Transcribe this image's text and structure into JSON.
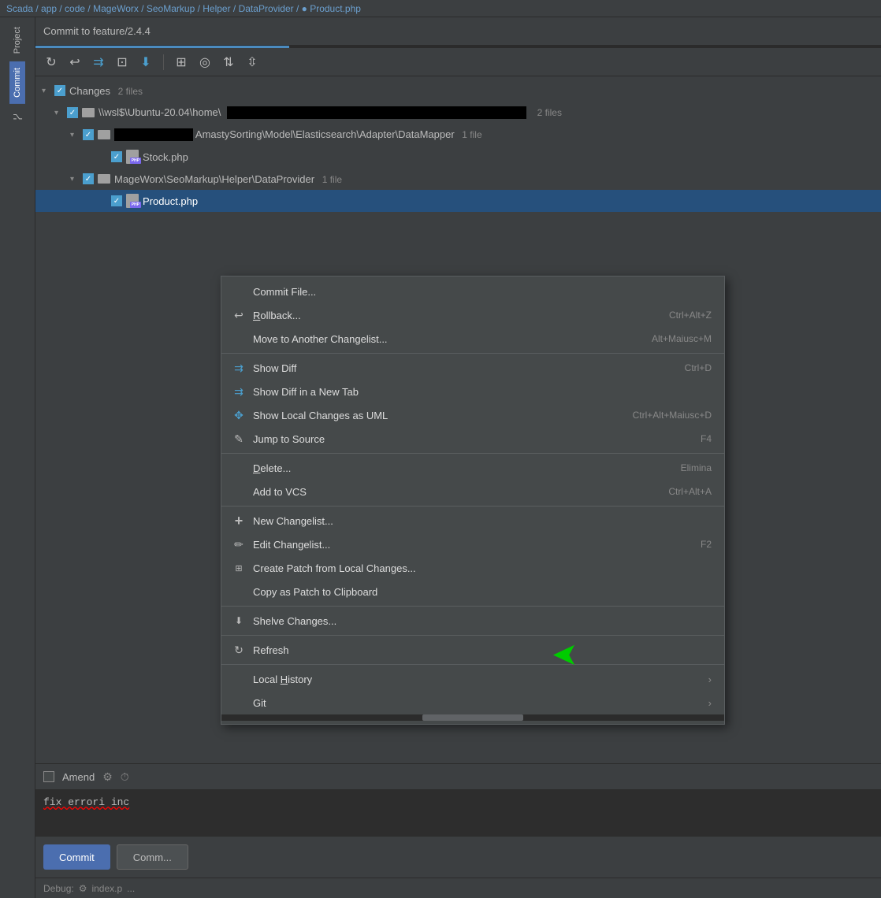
{
  "breadcrumb": {
    "text": "Scada / app / code / MageWorx / SeoMarkup / Helper / DataProvider / ● Product.php"
  },
  "sidebar": {
    "tabs": [
      {
        "id": "project",
        "label": "Project"
      },
      {
        "id": "commit",
        "label": "Commit"
      },
      {
        "id": "vcs",
        "label": "⌥"
      }
    ]
  },
  "title_bar": {
    "title": "Commit to feature/2.4.4"
  },
  "toolbar": {
    "buttons": [
      {
        "id": "refresh",
        "icon": "↻",
        "label": "Refresh"
      },
      {
        "id": "rollback",
        "icon": "↩",
        "label": "Rollback"
      },
      {
        "id": "diff",
        "icon": "⇉",
        "label": "Show Diff",
        "blue": true
      },
      {
        "id": "commit-file",
        "icon": "⊡",
        "label": "Commit File"
      },
      {
        "id": "download",
        "icon": "⬇",
        "label": "Update",
        "blue": true
      }
    ],
    "buttons2": [
      {
        "id": "grid",
        "icon": "⊞",
        "label": "Group"
      },
      {
        "id": "eye",
        "icon": "◎",
        "label": "Filter"
      },
      {
        "id": "expand",
        "icon": "⇅",
        "label": "Expand All"
      },
      {
        "id": "collapse",
        "icon": "⇳",
        "label": "Collapse All"
      }
    ]
  },
  "file_tree": {
    "changes_label": "Changes",
    "changes_count": "2 files",
    "folder1": {
      "path": "\\\\wsl$\\Ubuntu-20.04\\home\\",
      "count": "2 files"
    },
    "subfolder1": {
      "path": "AmastySorting\\Model\\Elasticsearch\\Adapter\\DataMapper",
      "count": "1 file",
      "files": [
        {
          "name": "Stock.php"
        }
      ]
    },
    "subfolder2": {
      "path": "MageWorx\\SeoMarkup\\Helper\\DataProvider",
      "count": "1 file",
      "files": [
        {
          "name": "Product.php"
        }
      ]
    }
  },
  "amend": {
    "label": "Amend"
  },
  "commit_message": {
    "text": "fix errori inc"
  },
  "buttons": {
    "commit": "Commit",
    "commit_and": "Comm..."
  },
  "debug_bar": {
    "label": "Debug:",
    "file": "index.p",
    "more": "..."
  },
  "context_menu": {
    "items": [
      {
        "id": "commit-file",
        "icon": "",
        "label": "Commit File...",
        "shortcut": "",
        "has_icon": false
      },
      {
        "id": "rollback",
        "icon": "↩",
        "label": "Rollback...",
        "shortcut": "Ctrl+Alt+Z",
        "has_icon": true
      },
      {
        "id": "move-changelist",
        "icon": "",
        "label": "Move to Another Changelist...",
        "shortcut": "Alt+Maiusc+M",
        "has_icon": false
      },
      {
        "id": "sep1",
        "type": "separator"
      },
      {
        "id": "show-diff",
        "icon": "⇉",
        "label": "Show Diff",
        "shortcut": "Ctrl+D",
        "has_icon": true,
        "blue": true
      },
      {
        "id": "show-diff-tab",
        "icon": "⇉",
        "label": "Show Diff in a New Tab",
        "shortcut": "",
        "has_icon": true,
        "blue": true
      },
      {
        "id": "show-uml",
        "icon": "✥",
        "label": "Show Local Changes as UML",
        "shortcut": "Ctrl+Alt+Maiusc+D",
        "has_icon": true,
        "blue": true
      },
      {
        "id": "jump-source",
        "icon": "✎",
        "label": "Jump to Source",
        "shortcut": "F4",
        "has_icon": true
      },
      {
        "id": "sep2",
        "type": "separator"
      },
      {
        "id": "delete",
        "icon": "",
        "label": "Delete...",
        "shortcut": "Elimina",
        "has_icon": false
      },
      {
        "id": "add-vcs",
        "icon": "",
        "label": "Add to VCS",
        "shortcut": "Ctrl+Alt+A",
        "has_icon": false
      },
      {
        "id": "sep3",
        "type": "separator"
      },
      {
        "id": "new-changelist",
        "icon": "+",
        "label": "New Changelist...",
        "shortcut": "",
        "has_icon": true
      },
      {
        "id": "edit-changelist",
        "icon": "✏",
        "label": "Edit Changelist...",
        "shortcut": "F2",
        "has_icon": true
      },
      {
        "id": "create-patch",
        "icon": "⊞",
        "label": "Create Patch from Local Changes...",
        "shortcut": "",
        "has_icon": true
      },
      {
        "id": "copy-patch",
        "icon": "",
        "label": "Copy as Patch to Clipboard",
        "shortcut": "",
        "has_icon": false
      },
      {
        "id": "sep4",
        "type": "separator"
      },
      {
        "id": "shelve",
        "icon": "⬇",
        "label": "Shelve Changes...",
        "shortcut": "",
        "has_icon": true
      },
      {
        "id": "sep5",
        "type": "separator"
      },
      {
        "id": "refresh",
        "icon": "↻",
        "label": "Refresh",
        "shortcut": "",
        "has_icon": true
      },
      {
        "id": "sep6",
        "type": "separator"
      },
      {
        "id": "local-history",
        "icon": "",
        "label": "Local History",
        "shortcut": "",
        "has_arrow": true,
        "has_icon": false
      },
      {
        "id": "git",
        "icon": "",
        "label": "Git",
        "shortcut": "",
        "has_arrow": true,
        "has_icon": false
      }
    ]
  }
}
